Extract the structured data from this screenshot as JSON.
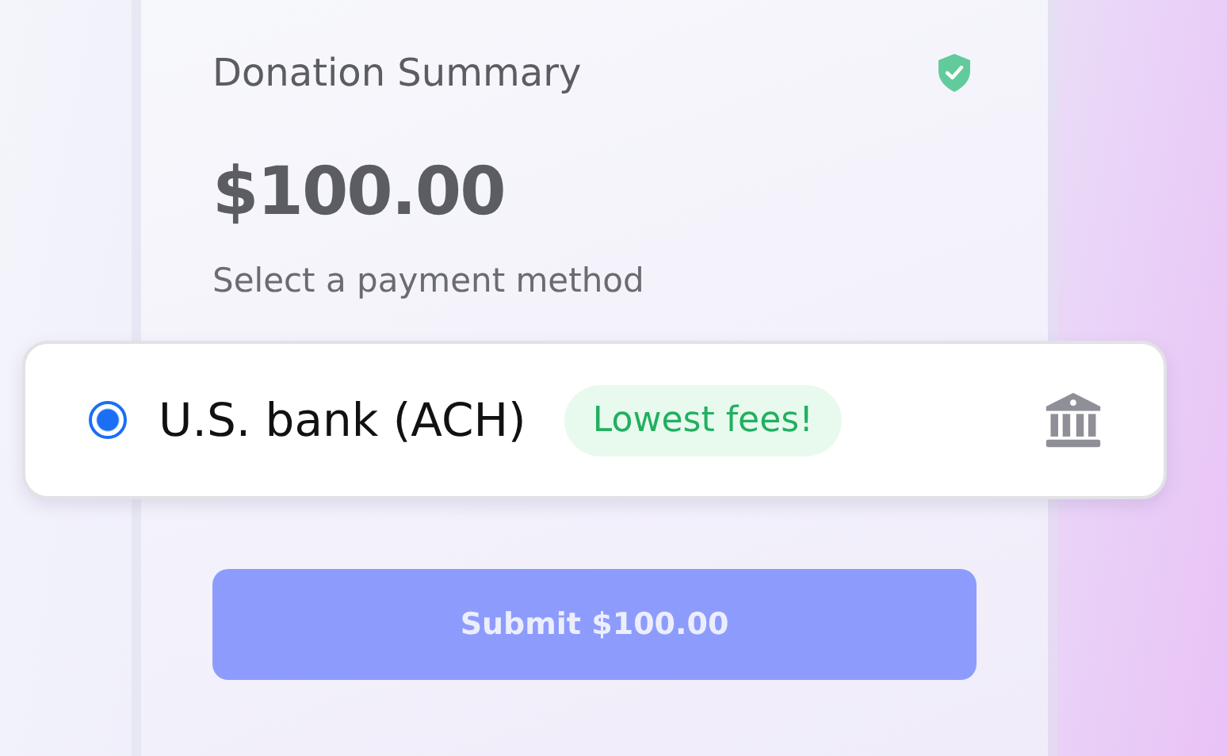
{
  "summary": {
    "title": "Donation Summary",
    "amount": "$100.00",
    "prompt": "Select a payment method"
  },
  "payment_methods": [
    {
      "label": "U.S. bank (ACH)",
      "selected": true,
      "badge": "Lowest fees!"
    }
  ],
  "submit": {
    "label": "Submit $100.00",
    "disabled": true
  }
}
